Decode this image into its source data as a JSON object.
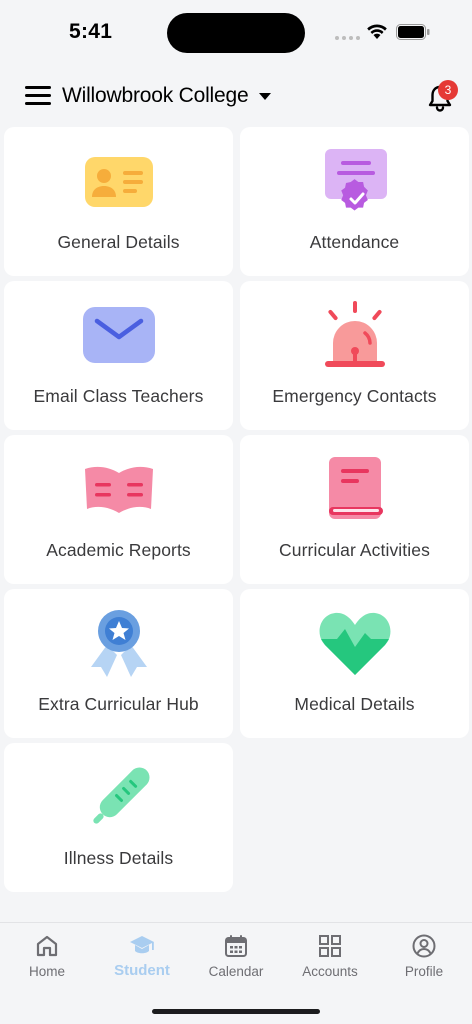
{
  "status_bar": {
    "time": "5:41"
  },
  "header": {
    "title": "Willowbrook College",
    "notification_count": "3"
  },
  "cards": [
    {
      "label": "General Details",
      "icon": "id-card-icon"
    },
    {
      "label": "Attendance",
      "icon": "certificate-icon"
    },
    {
      "label": "Email Class Teachers",
      "icon": "envelope-icon"
    },
    {
      "label": "Emergency Contacts",
      "icon": "siren-icon"
    },
    {
      "label": "Academic Reports",
      "icon": "open-book-icon"
    },
    {
      "label": "Curricular Activities",
      "icon": "book-icon"
    },
    {
      "label": "Extra Curricular Hub",
      "icon": "award-ribbon-icon"
    },
    {
      "label": "Medical Details",
      "icon": "heart-pulse-icon"
    },
    {
      "label": "Illness Details",
      "icon": "thermometer-icon"
    }
  ],
  "tabs": [
    {
      "label": "Home",
      "icon": "home-icon"
    },
    {
      "label": "Student",
      "icon": "graduation-cap-icon",
      "active": true
    },
    {
      "label": "Calendar",
      "icon": "calendar-icon"
    },
    {
      "label": "Accounts",
      "icon": "grid-icon"
    },
    {
      "label": "Profile",
      "icon": "user-circle-icon"
    }
  ],
  "colors": {
    "active_tab": "#a9cdf0",
    "badge": "#e53935",
    "card_bg": "#ffffff",
    "page_bg": "#f4f5f7"
  }
}
